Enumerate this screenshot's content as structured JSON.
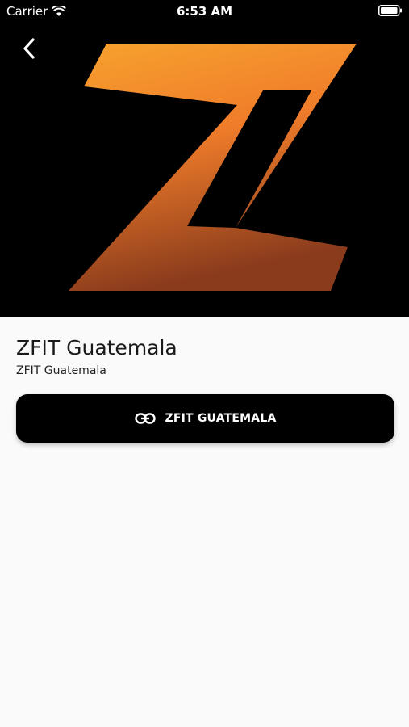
{
  "status_bar": {
    "carrier": "Carrier",
    "time": "6:53 AM",
    "wifi_icon": "wifi-icon",
    "battery_icon": "battery-icon"
  },
  "header": {
    "back_icon": "chevron-left-icon",
    "logo_icon": "z-logo",
    "background_color": "#000000",
    "logo_gradient": [
      "#f7a02c",
      "#8a3b1c"
    ]
  },
  "main": {
    "title": "ZFIT Guatemala",
    "subtitle": "ZFIT Guatemala",
    "link_button": {
      "label": "ZFIT GUATEMALA",
      "icon": "link-icon",
      "background_color": "#000000"
    }
  }
}
